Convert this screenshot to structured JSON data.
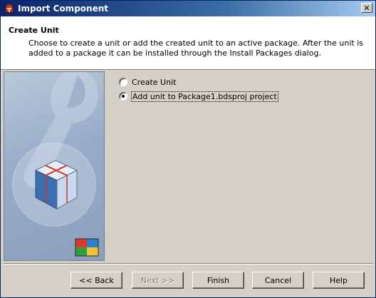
{
  "window": {
    "title": "Import Component"
  },
  "header": {
    "title": "Create Unit",
    "description_lines": [
      "Choose to create a unit or add the created unit to an active package. After the unit is",
      "added to a package it can be installed through the Install Packages dialog."
    ]
  },
  "options": [
    {
      "label": "Create Unit",
      "selected": false
    },
    {
      "label": "Add unit to Package1.bdsproj project",
      "selected": true
    }
  ],
  "buttons": {
    "back": "<< Back",
    "next": "Next >>",
    "finish": "Finish",
    "cancel": "Cancel",
    "help": "Help"
  },
  "icons": {
    "title": "delphi-helmet-icon",
    "close": "close-icon",
    "sidebar_art": "component-cube-wrench-illustration"
  },
  "colors": {
    "title_bar": "#0a246a",
    "dialog_face": "#d4d0c8"
  }
}
